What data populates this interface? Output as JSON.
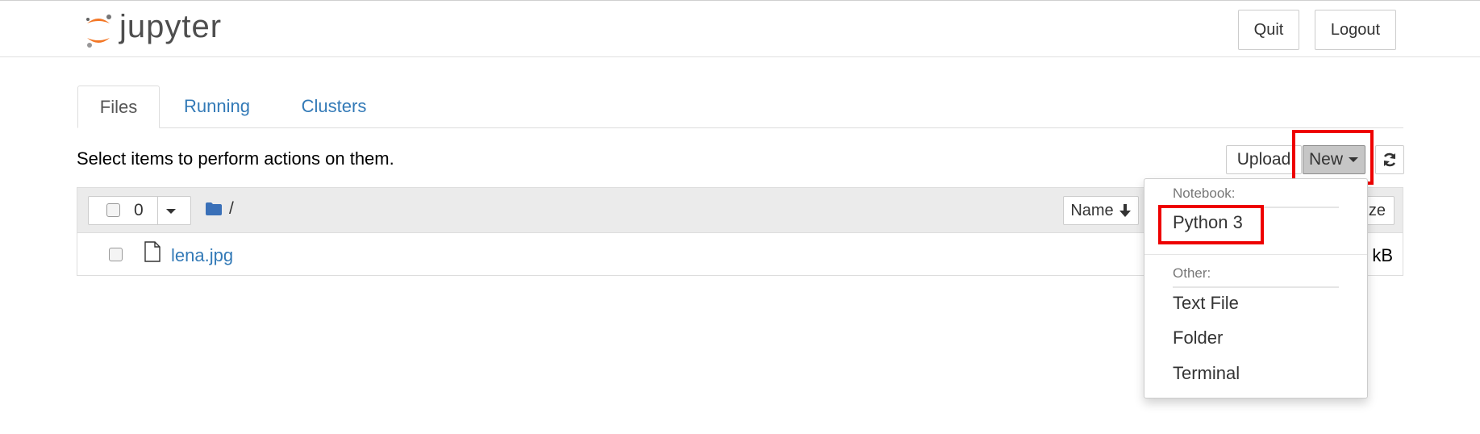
{
  "header": {
    "logo_text": "jupyter",
    "quit_label": "Quit",
    "logout_label": "Logout"
  },
  "tabs": [
    {
      "label": "Files",
      "active": true
    },
    {
      "label": "Running",
      "active": false
    },
    {
      "label": "Clusters",
      "active": false
    }
  ],
  "toolbar": {
    "instructions": "Select items to perform actions on them.",
    "upload_label": "Upload",
    "new_label": "New"
  },
  "list": {
    "selected_count": "0",
    "breadcrumb_root": "/",
    "name_column_label": "Name",
    "size_column_label": "ze",
    "files": [
      {
        "name": "lena.jpg",
        "size": "kB"
      }
    ]
  },
  "new_menu": {
    "notebook_header": "Notebook:",
    "notebook_items": [
      "Python 3"
    ],
    "other_header": "Other:",
    "other_items": [
      "Text File",
      "Folder",
      "Terminal"
    ]
  },
  "colors": {
    "link": "#337ab7",
    "highlight": "#ee0000",
    "logo_orange": "#f37726"
  },
  "icons": [
    "jupyter-logo",
    "caret-down-icon",
    "folder-icon",
    "arrow-down-icon",
    "refresh-icon",
    "file-icon"
  ]
}
